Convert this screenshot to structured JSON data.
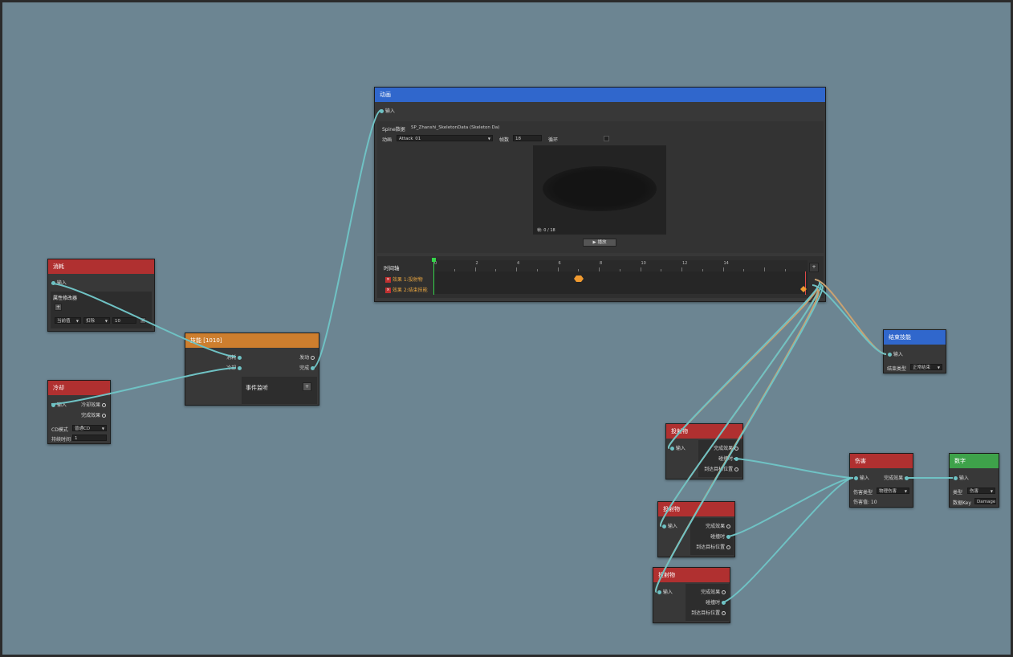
{
  "nodes": {
    "consume": {
      "title": "消耗",
      "input": "输入",
      "section": "属性修改器",
      "add": "+",
      "type": "当前值",
      "op": "扣除",
      "value": "10",
      "remove": "x"
    },
    "cooldown": {
      "title": "冷却",
      "input": "输入",
      "out1": "冷却效果",
      "out2": "完成效果",
      "cd_label": "CD模式",
      "cd_value": "普通CD",
      "time_label": "持续时间",
      "time_value": "1"
    },
    "skill": {
      "title": "技能 [1010]",
      "in1": "消耗",
      "in2": "冷却",
      "out1": "发动",
      "out2": "完成",
      "events": "事件监听",
      "events_add": "+"
    },
    "animation": {
      "title": "动画",
      "input": "输入",
      "spine_label": "Spine数据",
      "spine_value": "SP_Zhanshi_SkeletonData (Skeleton D⁠a)",
      "anim_label": "动画",
      "anim_value": "Attack_01",
      "frames_label": "帧数",
      "frames_value": "18",
      "loop_label": "循环",
      "frame_readout": "帧: 0 / 18",
      "play_label": "▶ 播放",
      "timeline_label": "时间轴",
      "ticks": [
        "0",
        "2",
        "4",
        "6",
        "8",
        "10",
        "12",
        "14"
      ],
      "add": "+",
      "events": [
        "效果 1:投射物",
        "效果 2:结束技能"
      ],
      "event_icon": "×"
    },
    "endskill": {
      "title": "结束技能",
      "input": "输入",
      "mode_label": "结束类型",
      "mode_value": "正常结束"
    },
    "proj1": {
      "title": "投射物",
      "input": "输入",
      "out1": "完成效果",
      "out2": "碰撞时",
      "out3": "到达目标位置"
    },
    "proj2": {
      "title": "投射物",
      "input": "输入",
      "out1": "完成效果",
      "out2": "碰撞时",
      "out3": "到达目标位置"
    },
    "proj3": {
      "title": "投射物",
      "input": "输入",
      "out1": "完成效果",
      "out2": "碰撞时",
      "out3": "到达目标位置"
    },
    "damage": {
      "title": "伤害",
      "input": "输入",
      "out1": "完成效果",
      "type_label": "伤害类型",
      "type_value": "物理伤害",
      "amount": "伤害值: 10"
    },
    "number": {
      "title": "数字",
      "input": "输入",
      "type_label": "类型",
      "type_value": "伤害",
      "key_label": "数据Key",
      "key_value": "Damage"
    }
  },
  "colors": {
    "canvas": "#6c8592",
    "wire": "#6fc2c4",
    "wire_orange": "#c9a272",
    "red": "#b03030",
    "orange": "#cd7e2e",
    "blue": "#3067cc",
    "green": "#3ea24a"
  }
}
